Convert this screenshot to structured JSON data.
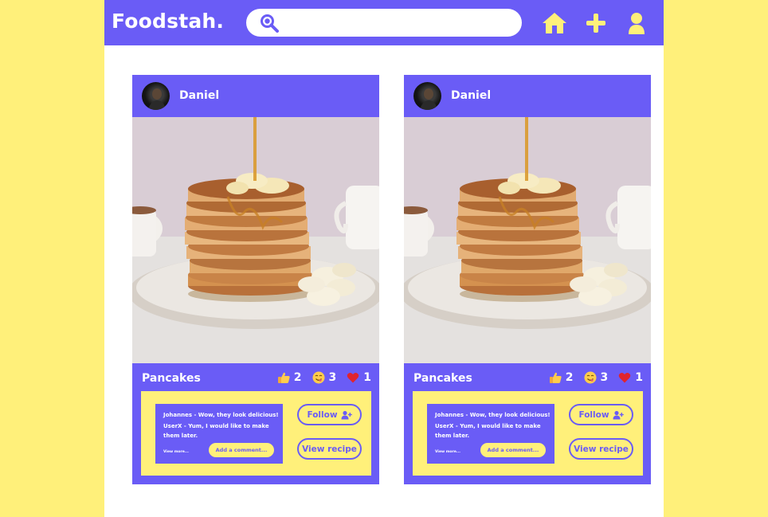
{
  "app": {
    "title": "Foodstah."
  },
  "search": {
    "placeholder": ""
  },
  "nav": {
    "icons": [
      "home-icon",
      "plus-icon",
      "user-icon"
    ]
  },
  "colors": {
    "brand": "#6a5cf6",
    "accent": "#fff07a",
    "background": "#ffffff"
  },
  "posts": [
    {
      "user": "Daniel",
      "title": "Pancakes",
      "reactions": {
        "thumbs_up": "2",
        "yum": "3",
        "heart": "1"
      },
      "comments": [
        "Johannes - Wow, they look delicious!",
        "UserX - Yum, I would like to make them later."
      ],
      "view_more": "View more...",
      "add_comment": "Add a comment...",
      "follow": "Follow",
      "view_recipe": "View recipe"
    },
    {
      "user": "Daniel",
      "title": "Pancakes",
      "reactions": {
        "thumbs_up": "2",
        "yum": "3",
        "heart": "1"
      },
      "comments": [
        "Johannes - Wow, they look delicious!",
        "UserX - Yum, I would like to make them later."
      ],
      "view_more": "View more...",
      "add_comment": "Add a comment...",
      "follow": "Follow",
      "view_recipe": "View recipe"
    }
  ]
}
